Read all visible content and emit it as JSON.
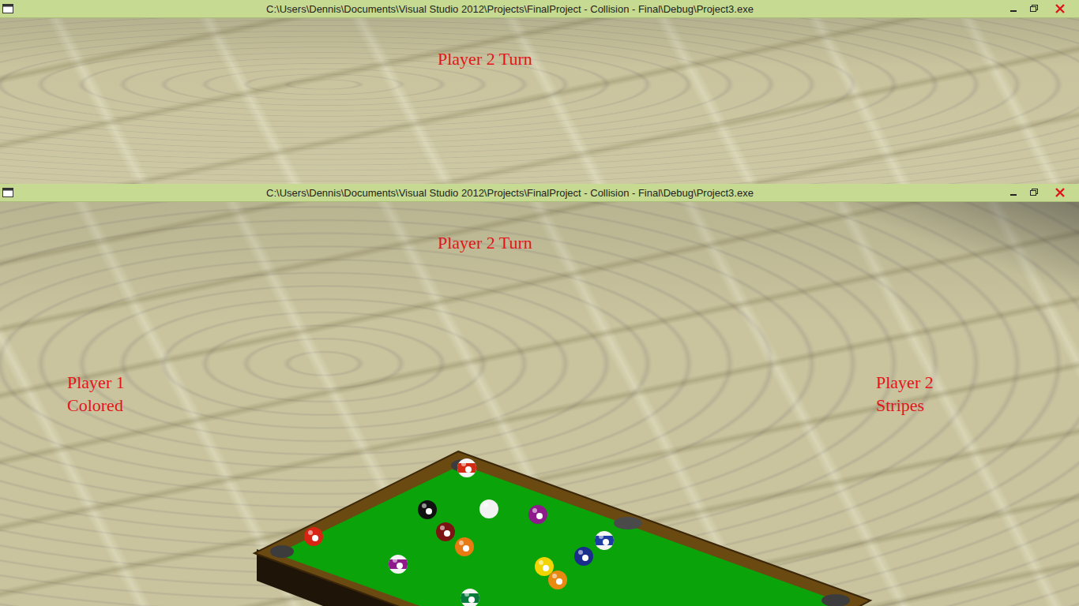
{
  "windows": [
    {
      "title": "C:\\Users\\Dennis\\Documents\\Visual Studio 2012\\Projects\\FinalProject - Collision - Final\\Debug\\Project3.exe",
      "turn": "Player 2 Turn",
      "players": [],
      "table": null
    },
    {
      "title": "C:\\Users\\Dennis\\Documents\\Visual Studio 2012\\Projects\\FinalProject - Collision - Final\\Debug\\Project3.exe",
      "turn": "Player 2 Turn",
      "players": [
        {
          "name": "Player 1",
          "group": "Colored"
        },
        {
          "name": "Player 2",
          "group": "Stripes"
        }
      ],
      "table": {
        "balls": [
          {
            "kind": "stripe",
            "color": "#d42a14"
          },
          {
            "kind": "eight",
            "color": "#111111"
          },
          {
            "kind": "cue",
            "color": "#f2f2f2"
          },
          {
            "kind": "solid",
            "color": "#8e1a8c"
          },
          {
            "kind": "solid",
            "color": "#7c1414"
          },
          {
            "kind": "solid",
            "color": "#e87a12"
          },
          {
            "kind": "solid",
            "color": "#d82412"
          },
          {
            "kind": "stripe",
            "color": "#8e1a8c"
          },
          {
            "kind": "stripe",
            "color": "#1c3ea4"
          },
          {
            "kind": "solid",
            "color": "#1a2c8c"
          },
          {
            "kind": "solid",
            "color": "#f2d400"
          },
          {
            "kind": "solid",
            "color": "#e88a12"
          },
          {
            "kind": "stripe",
            "color": "#0a7a3c"
          }
        ]
      }
    }
  ]
}
